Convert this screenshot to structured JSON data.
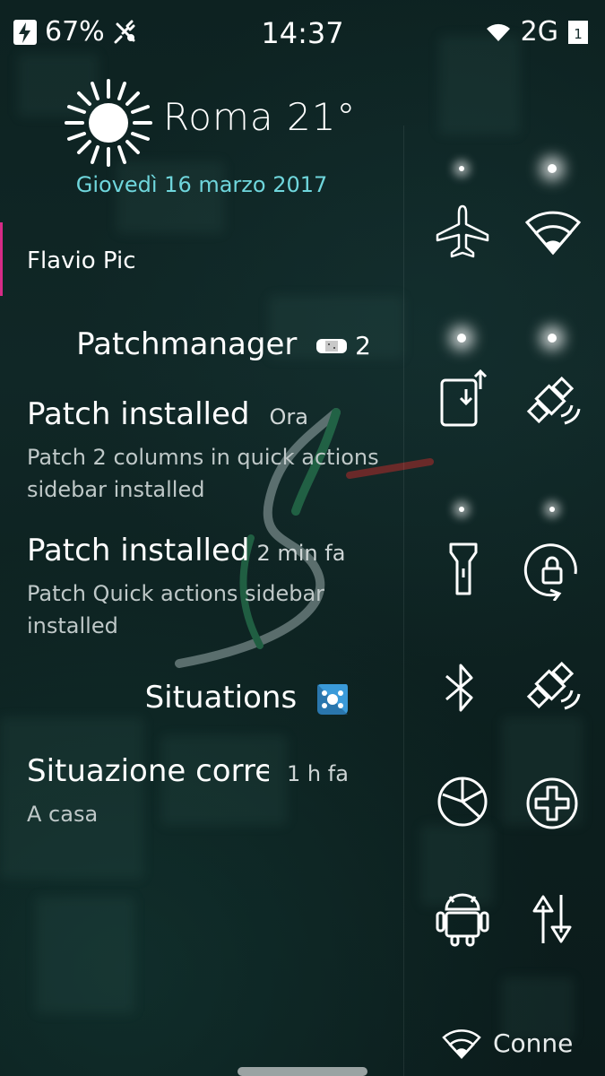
{
  "status_bar": {
    "battery_percent": "67%",
    "time": "14:37",
    "network": "2G",
    "sim": "1"
  },
  "weather": {
    "city_temp": "Roma 21°",
    "date": "Giovedì 16 marzo 2017"
  },
  "account": {
    "name": "Flavio Pic"
  },
  "patchmanager": {
    "title": "Patchmanager",
    "count": "2",
    "notifications": [
      {
        "title": "Patch installed",
        "time": "Ora",
        "body": "Patch 2 columns in quick actions sidebar installed"
      },
      {
        "title": "Patch installed",
        "time": "2 min fa",
        "body": "Patch Quick actions sidebar installed"
      }
    ]
  },
  "situations": {
    "title": "Situations",
    "notifications": [
      {
        "title": "Situazione corrente",
        "time": "1 h fa",
        "body": "A casa"
      }
    ]
  },
  "quick_actions": [
    {
      "icon": "airplane-icon",
      "active": false
    },
    {
      "icon": "wifi-icon",
      "active": true
    },
    {
      "icon": "screenshot-icon",
      "active": true
    },
    {
      "icon": "gps-icon",
      "active": true
    },
    {
      "icon": "flashlight-icon",
      "active": false
    },
    {
      "icon": "rotation-lock-icon",
      "active": false
    },
    {
      "icon": "bluetooth-icon",
      "active": false
    },
    {
      "icon": "gps-icon-2",
      "active": false
    },
    {
      "icon": "data-usage-icon",
      "active": false
    },
    {
      "icon": "add-icon",
      "active": false
    },
    {
      "icon": "android-icon",
      "active": false
    },
    {
      "icon": "mobile-data-icon",
      "active": false
    }
  ],
  "bottom": {
    "wifi_label": "Connected"
  },
  "colors": {
    "accent": "#6fd6dc",
    "account_bar": "#d62b86"
  }
}
